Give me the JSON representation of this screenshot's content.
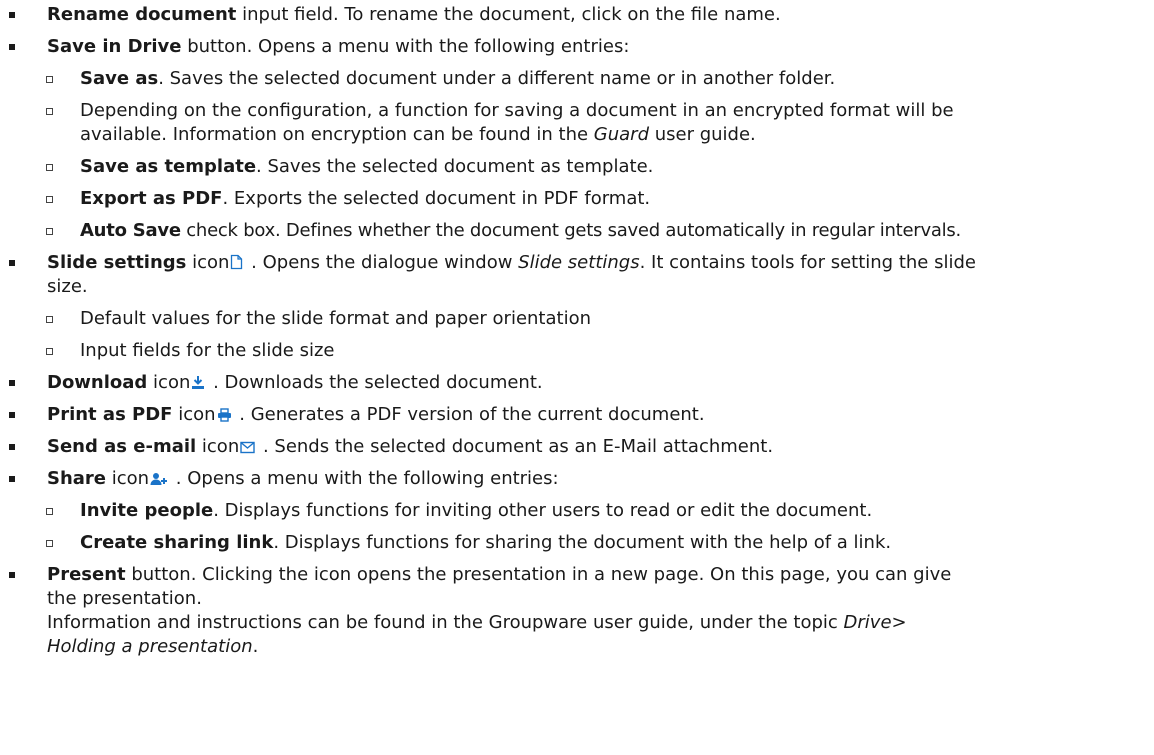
{
  "items": [
    {
      "bold": "Rename document",
      "text": " input field. To rename the document, click on the file name."
    },
    {
      "bold": "Save in Drive",
      "text": " button. Opens a menu with the following entries:"
    },
    {
      "bold": "Save as",
      "text": ". Saves the selected document under a different name or in another folder."
    },
    {
      "line1": "Depending on the configuration, a function for saving a document in an encrypted format will be",
      "line2a": "available. Information on encryption can be found in the ",
      "line2i": "Guard",
      "line2b": " user guide."
    },
    {
      "bold": "Save as template",
      "text": ". Saves the selected document as template."
    },
    {
      "bold": "Export as PDF",
      "text": ". Exports the selected document in PDF format."
    },
    {
      "bold": "Auto Save",
      "text": " check box. Defines whether the document gets saved automatically in regular intervals."
    },
    {
      "bold": "Slide settings",
      "word": " icon",
      "texta": " . Opens the dialogue window ",
      "italic": "Slide settings",
      "textb": ". It contains tools for setting the slide",
      "line2": "size.",
      "icon": "document-icon"
    },
    {
      "text": "Default values for the slide format and paper orientation"
    },
    {
      "text": "Input fields for the slide size"
    },
    {
      "bold": "Download",
      "word": " icon",
      "text": " . Downloads the selected document.",
      "icon": "download-icon"
    },
    {
      "bold": "Print as PDF",
      "word": " icon",
      "text": " . Generates a PDF version of the current document.",
      "icon": "print-icon"
    },
    {
      "bold": "Send as e-mail",
      "word": " icon",
      "text": " . Sends the selected document as an E-Mail attachment.",
      "icon": "envelope-icon"
    },
    {
      "bold": "Share",
      "word": " icon",
      "text": " . Opens a menu with the following entries:",
      "icon": "share-user-icon"
    },
    {
      "bold": "Invite people",
      "text": ". Displays functions for inviting other users to read or edit the document."
    },
    {
      "bold": "Create sharing link",
      "text": ". Displays functions for sharing the document with the help of a link."
    },
    {
      "bold": "Present",
      "text": " button. Clicking the icon opens the presentation in a new page. On this page, you can give",
      "line2": "the presentation.",
      "line3a": "Information and instructions can be found in the Groupware user guide, under the topic ",
      "line3i": "Drive",
      "line3b": ">",
      "line4i": "Holding a presentation",
      "line4b": "."
    }
  ],
  "colors": {
    "icon_blue": "#1a73c8",
    "text": "#1a1a1a"
  }
}
